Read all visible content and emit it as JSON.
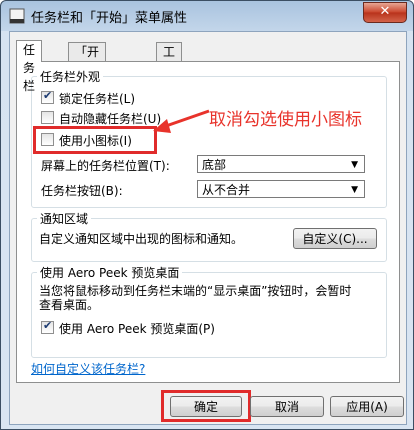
{
  "window": {
    "title": "任务栏和「开始」菜单属性",
    "close_label": "✕"
  },
  "tabs": [
    "任务栏",
    "「开始」菜单",
    "工具栏"
  ],
  "appearance": {
    "title": "任务栏外观",
    "lock": "锁定任务栏(L)",
    "autohide": "自动隐藏任务栏(U)",
    "small_icons": "使用小图标(I)",
    "location_label": "屏幕上的任务栏位置(T):",
    "location_value": "底部",
    "buttons_label": "任务栏按钮(B):",
    "buttons_value": "从不合并"
  },
  "notification": {
    "title": "通知区域",
    "desc": "自定义通知区域中出现的图标和通知。",
    "customize_button": "自定义(C)..."
  },
  "peek": {
    "title": "使用 Aero Peek 预览桌面",
    "desc_line1": "当您将鼠标移动到任务栏末端的“显示桌面”按钮时，会暂时",
    "desc_line2": "查看桌面。",
    "checkbox": "使用 Aero Peek 预览桌面(P)"
  },
  "help_link": "如何自定义该任务栏?",
  "buttons": {
    "ok": "确定",
    "cancel": "取消",
    "apply": "应用(A)"
  },
  "annotation": "取消勾选使用小图标",
  "colors": {
    "highlight": "#e02b2b",
    "link": "#0066cc"
  }
}
